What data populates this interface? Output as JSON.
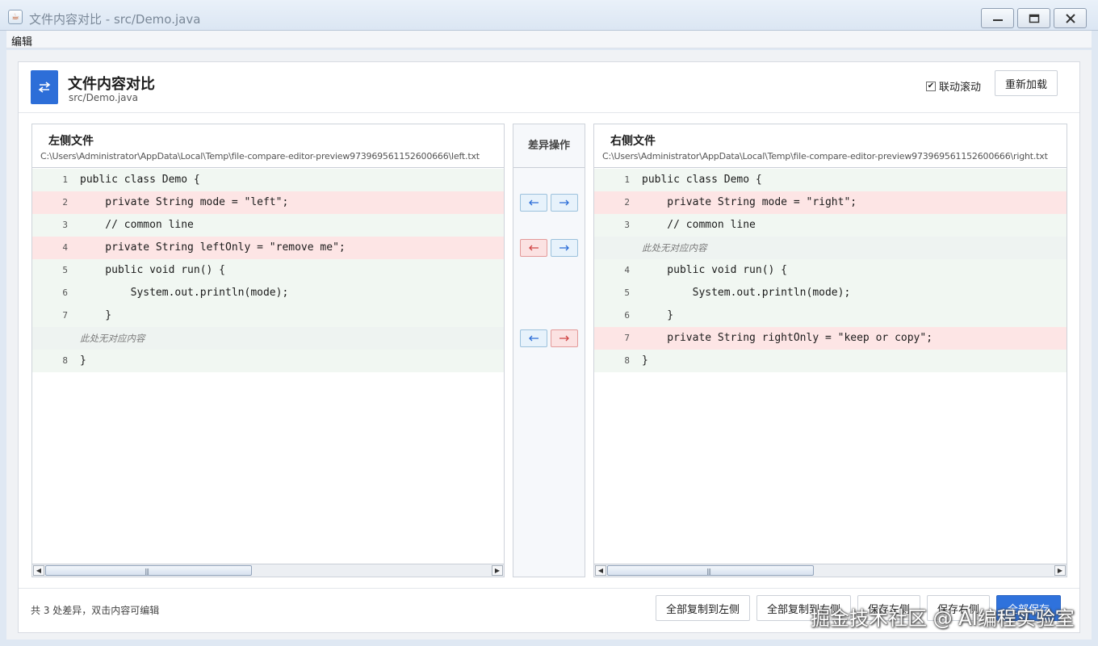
{
  "window": {
    "title": "文件内容对比 - src/Demo.java"
  },
  "menu": [
    "编辑"
  ],
  "header": {
    "title": "文件内容对比",
    "subtitle": "src/Demo.java",
    "sync_scroll_label": "联动滚动",
    "sync_scroll_checked": true,
    "reload_label": "重新加载"
  },
  "left": {
    "title": "左侧文件",
    "path": "C:\\Users\\Administrator\\AppData\\Local\\Temp\\file-compare-editor-preview973969561152600666\\left.txt",
    "lines": [
      {
        "num": "1",
        "text": "public class Demo {",
        "status": "same"
      },
      {
        "num": "2",
        "text": "    private String mode = \"left\";",
        "status": "diff"
      },
      {
        "num": "3",
        "text": "    // common line",
        "status": "same"
      },
      {
        "num": "4",
        "text": "    private String leftOnly = \"remove me\";",
        "status": "diff"
      },
      {
        "num": "5",
        "text": "    public void run() {",
        "status": "same"
      },
      {
        "num": "6",
        "text": "        System.out.println(mode);",
        "status": "same"
      },
      {
        "num": "7",
        "text": "    }",
        "status": "same"
      },
      {
        "num": "",
        "text": "此处无对应内容",
        "status": "placeholder"
      },
      {
        "num": "8",
        "text": "}",
        "status": "same"
      }
    ]
  },
  "right": {
    "title": "右侧文件",
    "path": "C:\\Users\\Administrator\\AppData\\Local\\Temp\\file-compare-editor-preview973969561152600666\\right.txt",
    "lines": [
      {
        "num": "1",
        "text": "public class Demo {",
        "status": "same"
      },
      {
        "num": "2",
        "text": "    private String mode = \"right\";",
        "status": "diff"
      },
      {
        "num": "3",
        "text": "    // common line",
        "status": "same"
      },
      {
        "num": "",
        "text": "此处无对应内容",
        "status": "placeholder"
      },
      {
        "num": "4",
        "text": "    public void run() {",
        "status": "same"
      },
      {
        "num": "5",
        "text": "        System.out.println(mode);",
        "status": "same"
      },
      {
        "num": "6",
        "text": "    }",
        "status": "same"
      },
      {
        "num": "7",
        "text": "    private String rightOnly = \"keep or copy\";",
        "status": "diff"
      },
      {
        "num": "8",
        "text": "}",
        "status": "same"
      }
    ]
  },
  "operations": {
    "title": "差异操作",
    "rows": [
      {
        "line_index": 1,
        "left_style": "blue",
        "right_style": "blue"
      },
      {
        "line_index": 3,
        "left_style": "red",
        "right_style": "blue"
      },
      {
        "line_index": 7,
        "left_style": "blue",
        "right_style": "red"
      }
    ],
    "colors": {
      "blue": "#2d6ed8",
      "red": "#d04545"
    }
  },
  "footer": {
    "summary": "共 3 处差异，双击内容可编辑",
    "buttons": {
      "copy_all_to_left": "全部复制到左侧",
      "copy_all_to_right": "全部复制到右侧",
      "save_left": "保存左侧",
      "save_right": "保存右侧",
      "save_all": "全部保存"
    }
  },
  "watermark": "掘金技术社区 @ AI编程实验室",
  "colors": {
    "accent": "#2f72dc",
    "diff_bg": "#fde5e5",
    "same_bg": "#f1f7f2"
  }
}
